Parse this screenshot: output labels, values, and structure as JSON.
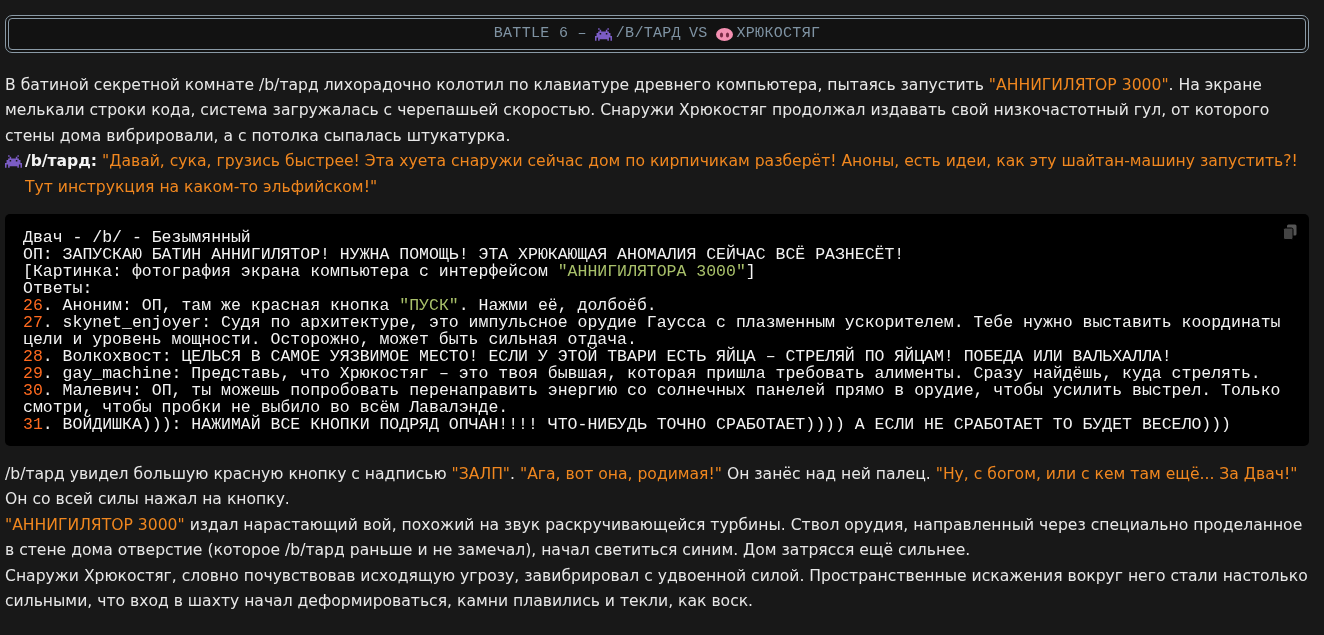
{
  "header": {
    "battle": "BATTLE 6 –",
    "left": "/B/ТАРД",
    "vs": "VS",
    "right": "ХРЮКОСТЯГ"
  },
  "intro": [
    {
      "kind": "narration",
      "segments": [
        {
          "kind": "plain",
          "text": "В батиной секретной комнате /b/тард лихорадочно колотил по клавиатуре древнего компьютера, пытаясь запустить "
        },
        {
          "kind": "quote",
          "text": "\"АННИГИЛЯТОР 3000\""
        },
        {
          "kind": "plain",
          "text": ". На экране мелькали строки кода, система загружалась с черепашьей скоростью. Снаружи Хрюкостяг продолжал издавать свой низкочастотный гул, от которого стены дома вибрировали, а с потолка сыпалась штукатурка."
        }
      ]
    },
    {
      "kind": "speech",
      "speaker": "/b/тард:",
      "quote": "\"Давай, сука, грузись быстрее! Эта хуета снаружи сейчас дом по кирпичикам разберёт! Аноны, есть идеи, как эту шайтан-машину запустить?! Тут инструкция на каком-то эльфийском!\""
    }
  ],
  "code_block": {
    "lines": [
      {
        "segments": [
          {
            "kind": "plain",
            "text": "Двач - /b/ - Безымянный"
          }
        ]
      },
      {
        "segments": [
          {
            "kind": "plain",
            "text": "ОП: ЗАПУСКАЮ БАТИН АННИГИЛЯТОР! НУЖНА ПОМОЩЬ! ЭТА ХРЮКАЮЩАЯ АНОМАЛИЯ СЕЙЧАС ВСЁ РАЗНЕСЁТ!"
          }
        ]
      },
      {
        "segments": [
          {
            "kind": "plain",
            "text": "[Картинка: фотография экрана компьютера с интерфейсом "
          },
          {
            "kind": "string",
            "text": "\"АННИГИЛЯТОРА 3000\""
          },
          {
            "kind": "plain",
            "text": "]"
          }
        ]
      },
      {
        "segments": [
          {
            "kind": "plain",
            "text": "Ответы:"
          }
        ]
      },
      {
        "segments": [
          {
            "kind": "number",
            "text": "26"
          },
          {
            "kind": "plain",
            "text": ". Аноним: ОП, там же красная кнопка "
          },
          {
            "kind": "string",
            "text": "\"ПУСК\""
          },
          {
            "kind": "plain",
            "text": ". Нажми её, долбоёб."
          }
        ]
      },
      {
        "segments": [
          {
            "kind": "number",
            "text": "27"
          },
          {
            "kind": "plain",
            "text": ". skynet_enjoyer: Судя по архитектуре, это импульсное орудие Гаусса с плазменным ускорителем. Тебе нужно выставить координаты цели и уровень мощности. Осторожно, может быть сильная отдача."
          }
        ]
      },
      {
        "segments": [
          {
            "kind": "number",
            "text": "28"
          },
          {
            "kind": "plain",
            "text": ". Волкохвост: ЦЕЛЬСЯ В САМОЕ УЯЗВИМОЕ МЕСТО! ЕСЛИ У ЭТОЙ ТВАРИ ЕСТЬ ЯЙЦА – СТРЕЛЯЙ ПО ЯЙЦАМ! ПОБЕДА ИЛИ ВАЛЬХАЛЛА!"
          }
        ]
      },
      {
        "segments": [
          {
            "kind": "number",
            "text": "29"
          },
          {
            "kind": "plain",
            "text": ". gay_machine: Представь, что Хрюкостяг – это твоя бывшая, которая пришла требовать алименты. Сразу найдёшь, куда стрелять."
          }
        ]
      },
      {
        "segments": [
          {
            "kind": "number",
            "text": "30"
          },
          {
            "kind": "plain",
            "text": ". Малевич: ОП, ты можешь попробовать перенаправить энергию со солнечных панелей прямо в орудие, чтобы усилить выстрел. Только смотри, чтобы пробки не выбило во всём Лавалэнде."
          }
        ]
      },
      {
        "segments": [
          {
            "kind": "number",
            "text": "31"
          },
          {
            "kind": "plain",
            "text": ". ВОЙДИШКА))): НАЖИМАЙ ВСЕ КНОПКИ ПОДРЯД ОПЧАН!!!! ЧТО-НИБУДЬ ТОЧНО СРАБОТАЕТ)))) А ЕСЛИ НЕ СРАБОТАЕТ ТО БУДЕТ ВЕСЕЛО)))"
          }
        ]
      }
    ]
  },
  "outro": [
    {
      "kind": "narration",
      "segments": [
        {
          "kind": "plain",
          "text": "/b/тард увидел большую красную кнопку с надписью "
        },
        {
          "kind": "quote",
          "text": "\"ЗАЛП\""
        },
        {
          "kind": "plain",
          "text": ". "
        },
        {
          "kind": "quote",
          "text": "\"Ага, вот она, родимая!\""
        },
        {
          "kind": "plain",
          "text": " Он занёс над ней палец. "
        },
        {
          "kind": "quote",
          "text": "\"Ну, с богом, или с кем там ещё... За Двач!\""
        },
        {
          "kind": "plain",
          "text": " Он со всей силы нажал на кнопку."
        }
      ]
    },
    {
      "kind": "narration",
      "segments": [
        {
          "kind": "quote",
          "text": "\"АННИГИЛЯТОР 3000\""
        },
        {
          "kind": "plain",
          "text": " издал нарастающий вой, похожий на звук раскручивающейся турбины. Ствол орудия, направленный через специально проделанное в стене дома отверстие (которое /b/тард раньше и не замечал), начал светиться синим. Дом затрясся ещё сильнее."
        }
      ]
    },
    {
      "kind": "narration",
      "segments": [
        {
          "kind": "plain",
          "text": "Снаружи Хрюкостяг, словно почувствовав исходящую угрозу, завибрировал с удвоенной силой. Пространственные искажения вокруг него стали настолько сильными, что вход в шахту начал деформироваться, камни плавились и текли, как воск."
        }
      ]
    }
  ]
}
